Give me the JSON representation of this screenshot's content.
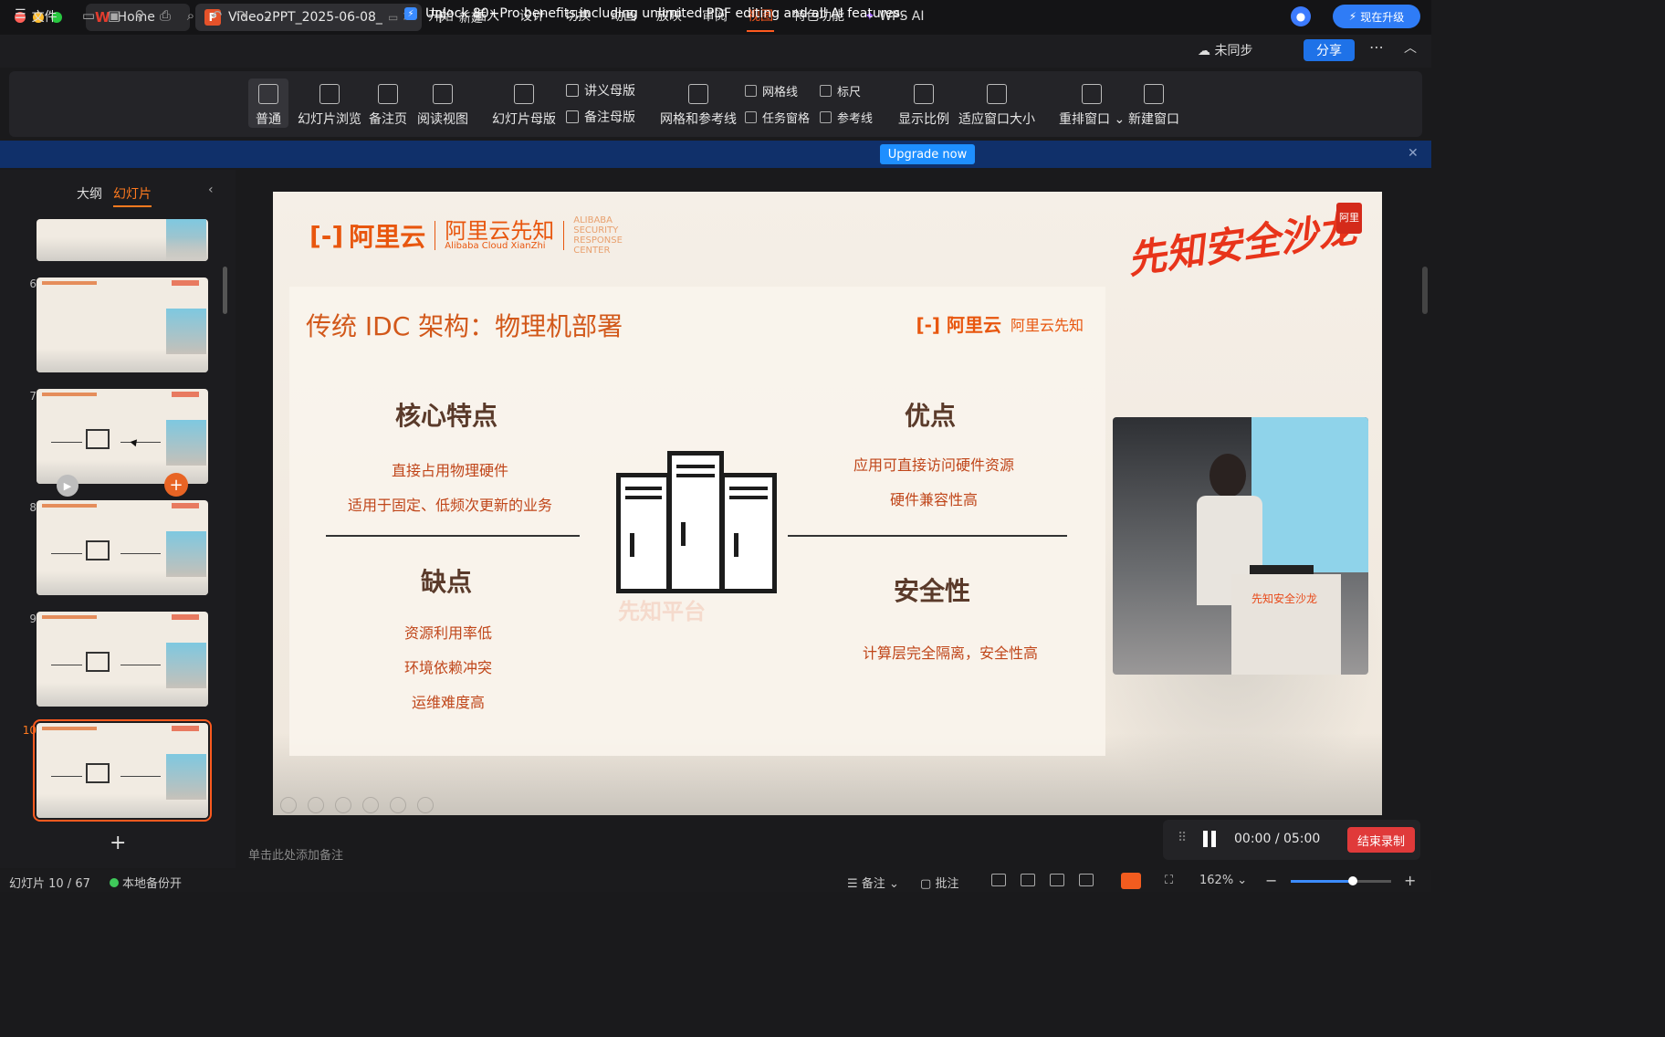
{
  "window": {
    "tabs": [
      {
        "label": "Home"
      },
      {
        "label": "Video2PPT_2025-06-08_"
      }
    ],
    "new_tab_label": "新建",
    "upgrade_label": "现在升级",
    "traffic_colors": [
      "#ff5f57",
      "#febc2e",
      "#28c840"
    ]
  },
  "menubar": {
    "file_label": "文件",
    "menus": [
      "开始",
      "插入",
      "设计",
      "切换",
      "动画",
      "放映",
      "审阅",
      "视图",
      "特色功能",
      "WPS AI"
    ],
    "active_menu": "视图",
    "unsync_label": "未同步",
    "share_label": "分享"
  },
  "ribbon": {
    "buttons": [
      "普通",
      "幻灯片浏览",
      "备注页",
      "阅读视图",
      "幻灯片母版",
      "讲义母版",
      "备注母版",
      "网格和参考线",
      "网格线",
      "任务窗格",
      "标尺",
      "参考线",
      "显示比例",
      "适应窗口大小",
      "重排窗口",
      "新建窗口"
    ]
  },
  "banner": {
    "text": "Unlock 80+Pro benefits,including unlimited PDF editing and all AI features.",
    "button": "Upgrade now"
  },
  "sidebar": {
    "tabs": [
      "大纲",
      "幻灯片"
    ],
    "active_tab": "幻灯片",
    "slide_numbers": [
      "6",
      "7",
      "8",
      "9",
      "10"
    ],
    "selected": "10"
  },
  "slide": {
    "brand": "阿里云",
    "brand2": "阿里云先知",
    "brand2_sub": "Alibaba Cloud XianZhi",
    "brand3": "ALIBABA SECURITY RESPONSE CENTER",
    "calligraphy": "先知安全沙龙",
    "seal": "阿里",
    "title": "传统 IDC 架构：物理机部署",
    "core": {
      "heading": "核心特点",
      "items": [
        "直接占用物理硬件",
        "适用于固定、低频次更新的业务"
      ]
    },
    "pros": {
      "heading": "优点",
      "items": [
        "应用可直接访问硬件资源",
        "硬件兼容性高"
      ]
    },
    "cons": {
      "heading": "缺点",
      "items": [
        "资源利用率低",
        "环境依赖冲突",
        "运维难度高"
      ]
    },
    "security": {
      "heading": "安全性",
      "items": [
        "计算层完全隔离，安全性高"
      ]
    },
    "watermark": "先知平台",
    "podium_text": "先知安全沙龙"
  },
  "notes_placeholder": "单击此处添加备注",
  "recording": {
    "elapsed": "00:00",
    "separator": "/",
    "total": "05:00",
    "stop_label": "结束录制"
  },
  "statusbar": {
    "slide_info": "幻灯片 10 / 67",
    "backup": "本地备份开",
    "notes": "备注",
    "comments": "批注",
    "zoom": "162%",
    "zoom_level": 0.62
  }
}
